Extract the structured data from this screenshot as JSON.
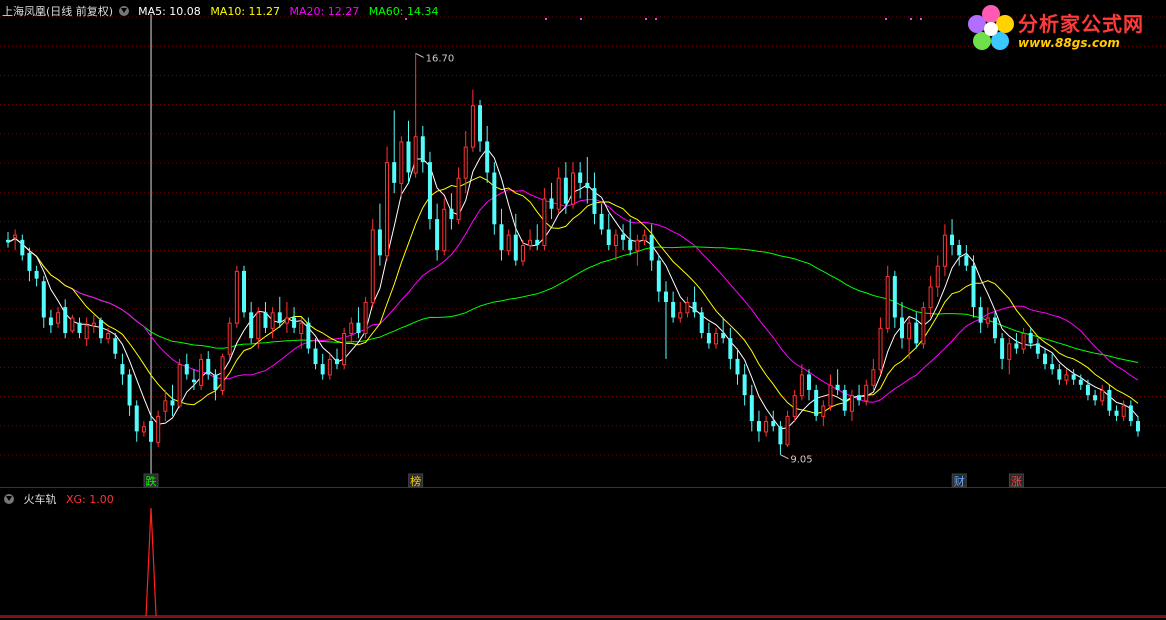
{
  "header": {
    "stock": "上海凤凰(日线 前复权)",
    "ma_labels": [
      {
        "text": "MA5: 10.08",
        "color": "#ffffff"
      },
      {
        "text": "MA10: 11.27",
        "color": "#ffff00"
      },
      {
        "text": "MA20: 12.27",
        "color": "#ff00ff"
      },
      {
        "text": "MA60: 14.34",
        "color": "#00ff00"
      }
    ]
  },
  "indicator": {
    "name": "火车轨",
    "xg_label": "XG: 1.00"
  },
  "logo": {
    "line1": "分析家公式网",
    "line2": "www.88gs.com"
  },
  "markers": [
    {
      "text": "跌",
      "bar": 20,
      "color": "#00ff00"
    },
    {
      "text": "榜",
      "bar": 57,
      "color": "#ffcc00"
    },
    {
      "text": "财",
      "bar": 133,
      "color": "#66aaff"
    },
    {
      "text": "涨",
      "bar": 141,
      "color": "#ff4444"
    }
  ],
  "annotations": {
    "high": "16.70",
    "low": "9.05"
  },
  "colors": {
    "up": "#ff3232",
    "down": "#54fcfc",
    "grid": "#7a0000",
    "panel_border": "#b00000"
  },
  "chart_data": {
    "type": "candlestick",
    "price_range": [
      8.5,
      17.5
    ],
    "ohlc": [
      [
        13.1,
        13.25,
        12.95,
        13.05
      ],
      [
        13.15,
        13.3,
        12.9,
        13.2
      ],
      [
        13.1,
        13.2,
        12.7,
        12.8
      ],
      [
        12.85,
        12.95,
        12.3,
        12.5
      ],
      [
        12.5,
        12.6,
        12.2,
        12.35
      ],
      [
        12.3,
        12.4,
        11.4,
        11.6
      ],
      [
        11.6,
        11.75,
        11.3,
        11.45
      ],
      [
        11.5,
        11.8,
        11.4,
        11.7
      ],
      [
        11.8,
        11.95,
        11.2,
        11.3
      ],
      [
        11.35,
        11.65,
        11.3,
        11.6
      ],
      [
        11.5,
        11.6,
        11.2,
        11.3
      ],
      [
        11.2,
        11.6,
        11.05,
        11.45
      ],
      [
        11.45,
        11.65,
        11.3,
        11.5
      ],
      [
        11.55,
        11.6,
        11.1,
        11.2
      ],
      [
        11.2,
        11.4,
        11.1,
        11.3
      ],
      [
        11.2,
        11.3,
        10.8,
        10.9
      ],
      [
        10.7,
        10.9,
        10.3,
        10.5
      ],
      [
        10.5,
        10.6,
        9.7,
        9.9
      ],
      [
        9.9,
        10.0,
        9.2,
        9.4
      ],
      [
        9.4,
        9.6,
        9.3,
        9.5
      ],
      [
        9.6,
        9.7,
        9.05,
        9.2
      ],
      [
        9.2,
        9.8,
        9.1,
        9.7
      ],
      [
        9.8,
        10.2,
        9.6,
        10.0
      ],
      [
        10.0,
        10.3,
        9.7,
        9.9
      ],
      [
        9.9,
        10.8,
        9.85,
        10.7
      ],
      [
        10.7,
        10.9,
        10.4,
        10.5
      ],
      [
        10.4,
        10.6,
        10.2,
        10.35
      ],
      [
        10.3,
        10.9,
        10.2,
        10.8
      ],
      [
        10.8,
        10.95,
        10.4,
        10.5
      ],
      [
        10.5,
        10.6,
        10.0,
        10.2
      ],
      [
        10.2,
        10.9,
        10.1,
        10.85
      ],
      [
        10.9,
        11.6,
        10.8,
        11.5
      ],
      [
        11.5,
        12.6,
        11.4,
        12.5
      ],
      [
        12.5,
        12.6,
        11.6,
        11.7
      ],
      [
        11.7,
        11.9,
        11.1,
        11.2
      ],
      [
        11.2,
        11.8,
        11.0,
        11.7
      ],
      [
        11.7,
        11.9,
        11.3,
        11.4
      ],
      [
        11.4,
        11.8,
        11.2,
        11.7
      ],
      [
        11.7,
        12.0,
        11.4,
        11.5
      ],
      [
        11.5,
        11.9,
        11.3,
        11.6
      ],
      [
        11.6,
        11.8,
        11.3,
        11.4
      ],
      [
        11.3,
        11.6,
        11.0,
        11.5
      ],
      [
        11.5,
        11.6,
        10.9,
        11.0
      ],
      [
        11.0,
        11.2,
        10.6,
        10.7
      ],
      [
        10.7,
        10.9,
        10.4,
        10.5
      ],
      [
        10.5,
        10.9,
        10.4,
        10.8
      ],
      [
        10.8,
        11.0,
        10.6,
        10.7
      ],
      [
        10.7,
        11.4,
        10.6,
        11.3
      ],
      [
        11.3,
        11.6,
        11.1,
        11.5
      ],
      [
        11.5,
        11.8,
        11.2,
        11.3
      ],
      [
        11.3,
        12.0,
        11.2,
        11.9
      ],
      [
        11.9,
        13.5,
        11.8,
        13.3
      ],
      [
        13.3,
        13.8,
        12.6,
        12.8
      ],
      [
        12.8,
        14.9,
        12.7,
        14.6
      ],
      [
        14.6,
        15.6,
        14.0,
        14.2
      ],
      [
        14.2,
        15.1,
        13.9,
        15.0
      ],
      [
        15.0,
        15.4,
        14.2,
        14.4
      ],
      [
        14.4,
        16.7,
        14.3,
        15.1
      ],
      [
        15.1,
        15.3,
        14.4,
        14.6
      ],
      [
        14.6,
        14.8,
        13.3,
        13.5
      ],
      [
        13.5,
        13.8,
        12.7,
        12.9
      ],
      [
        12.9,
        13.9,
        12.8,
        13.7
      ],
      [
        13.7,
        14.0,
        13.3,
        13.5
      ],
      [
        13.5,
        14.5,
        13.4,
        14.3
      ],
      [
        14.3,
        15.2,
        14.0,
        14.9
      ],
      [
        14.9,
        16.0,
        14.8,
        15.7
      ],
      [
        15.7,
        15.8,
        14.8,
        15.0
      ],
      [
        15.0,
        15.3,
        14.2,
        14.4
      ],
      [
        14.4,
        14.6,
        13.2,
        13.4
      ],
      [
        13.4,
        13.7,
        12.7,
        12.9
      ],
      [
        12.9,
        13.3,
        12.8,
        13.2
      ],
      [
        13.2,
        13.6,
        12.6,
        12.7
      ],
      [
        12.7,
        13.1,
        12.6,
        13.0
      ],
      [
        13.0,
        13.3,
        12.9,
        13.1
      ],
      [
        13.1,
        13.4,
        12.9,
        13.0
      ],
      [
        13.0,
        14.1,
        12.9,
        13.9
      ],
      [
        13.9,
        14.2,
        13.5,
        13.7
      ],
      [
        13.7,
        14.5,
        13.6,
        14.3
      ],
      [
        14.3,
        14.6,
        13.6,
        13.8
      ],
      [
        13.8,
        14.6,
        13.7,
        14.4
      ],
      [
        14.4,
        14.6,
        13.9,
        14.2
      ],
      [
        14.2,
        14.7,
        13.8,
        14.1
      ],
      [
        14.1,
        14.4,
        13.4,
        13.6
      ],
      [
        13.6,
        13.8,
        13.2,
        13.3
      ],
      [
        13.3,
        13.6,
        12.9,
        13.0
      ],
      [
        13.0,
        13.3,
        12.7,
        13.2
      ],
      [
        13.2,
        13.4,
        12.9,
        13.1
      ],
      [
        13.1,
        13.5,
        12.8,
        12.9
      ],
      [
        12.9,
        13.2,
        12.6,
        13.1
      ],
      [
        13.1,
        13.3,
        13.0,
        13.2
      ],
      [
        13.2,
        13.4,
        12.5,
        12.7
      ],
      [
        12.7,
        12.8,
        11.9,
        12.1
      ],
      [
        12.1,
        12.3,
        10.8,
        11.9
      ],
      [
        11.9,
        12.1,
        11.5,
        11.6
      ],
      [
        11.6,
        11.9,
        11.5,
        11.7
      ],
      [
        11.7,
        12.0,
        11.6,
        11.9
      ],
      [
        11.9,
        12.2,
        11.6,
        11.7
      ],
      [
        11.7,
        11.8,
        11.2,
        11.3
      ],
      [
        11.3,
        11.5,
        11.0,
        11.1
      ],
      [
        11.1,
        11.4,
        11.0,
        11.3
      ],
      [
        11.3,
        11.6,
        11.1,
        11.2
      ],
      [
        11.2,
        11.4,
        10.6,
        10.8
      ],
      [
        10.8,
        11.0,
        10.3,
        10.5
      ],
      [
        10.5,
        10.7,
        9.9,
        10.1
      ],
      [
        10.1,
        10.3,
        9.4,
        9.6
      ],
      [
        9.6,
        9.8,
        9.2,
        9.4
      ],
      [
        9.4,
        9.7,
        9.3,
        9.6
      ],
      [
        9.6,
        9.8,
        9.4,
        9.5
      ],
      [
        9.5,
        9.6,
        8.95,
        9.15
      ],
      [
        9.15,
        9.8,
        9.1,
        9.7
      ],
      [
        9.7,
        10.2,
        9.6,
        10.1
      ],
      [
        10.1,
        10.7,
        10.0,
        10.5
      ],
      [
        10.5,
        10.6,
        10.0,
        10.2
      ],
      [
        10.2,
        10.3,
        9.6,
        9.7
      ],
      [
        9.7,
        10.0,
        9.5,
        9.9
      ],
      [
        9.9,
        10.5,
        9.8,
        10.3
      ],
      [
        10.3,
        10.6,
        10.1,
        10.2
      ],
      [
        10.2,
        10.3,
        9.7,
        9.8
      ],
      [
        9.8,
        10.2,
        9.6,
        10.1
      ],
      [
        10.1,
        10.3,
        9.9,
        10.0
      ],
      [
        10.0,
        10.4,
        9.9,
        10.3
      ],
      [
        10.3,
        10.8,
        10.2,
        10.6
      ],
      [
        10.6,
        11.6,
        10.5,
        11.4
      ],
      [
        11.4,
        12.6,
        11.3,
        12.4
      ],
      [
        12.4,
        12.5,
        11.4,
        11.6
      ],
      [
        11.6,
        11.9,
        11.0,
        11.2
      ],
      [
        11.2,
        11.6,
        10.8,
        11.5
      ],
      [
        11.5,
        11.7,
        11.0,
        11.1
      ],
      [
        11.1,
        11.9,
        11.0,
        11.8
      ],
      [
        11.8,
        12.4,
        11.6,
        12.2
      ],
      [
        12.2,
        12.8,
        12.0,
        12.6
      ],
      [
        12.6,
        13.4,
        12.4,
        13.2
      ],
      [
        13.2,
        13.5,
        12.8,
        13.0
      ],
      [
        13.0,
        13.1,
        12.6,
        12.8
      ],
      [
        12.8,
        13.0,
        12.5,
        12.6
      ],
      [
        12.6,
        12.8,
        11.6,
        11.8
      ],
      [
        11.8,
        12.0,
        11.3,
        11.5
      ],
      [
        11.5,
        11.8,
        11.4,
        11.6
      ],
      [
        11.6,
        11.7,
        11.1,
        11.2
      ],
      [
        11.2,
        11.3,
        10.6,
        10.8
      ],
      [
        10.8,
        11.2,
        10.5,
        11.1
      ],
      [
        11.1,
        11.3,
        10.9,
        11.0
      ],
      [
        11.0,
        11.4,
        10.9,
        11.3
      ],
      [
        11.3,
        11.4,
        11.0,
        11.1
      ],
      [
        11.1,
        11.2,
        10.8,
        10.9
      ],
      [
        10.9,
        11.0,
        10.6,
        10.7
      ],
      [
        10.7,
        10.9,
        10.5,
        10.6
      ],
      [
        10.6,
        10.7,
        10.3,
        10.4
      ],
      [
        10.4,
        10.6,
        10.3,
        10.5
      ],
      [
        10.5,
        10.6,
        10.3,
        10.4
      ],
      [
        10.4,
        10.5,
        10.2,
        10.3
      ],
      [
        10.3,
        10.4,
        10.0,
        10.1
      ],
      [
        10.1,
        10.2,
        9.9,
        10.0
      ],
      [
        10.0,
        10.3,
        9.9,
        10.2
      ],
      [
        10.2,
        10.3,
        9.7,
        9.8
      ],
      [
        9.8,
        9.9,
        9.6,
        9.7
      ],
      [
        9.7,
        10.0,
        9.6,
        9.9
      ],
      [
        9.9,
        10.0,
        9.5,
        9.6
      ],
      [
        9.6,
        9.7,
        9.3,
        9.4
      ]
    ],
    "xg_signal_bar": 20,
    "xg_value": 1.0
  }
}
